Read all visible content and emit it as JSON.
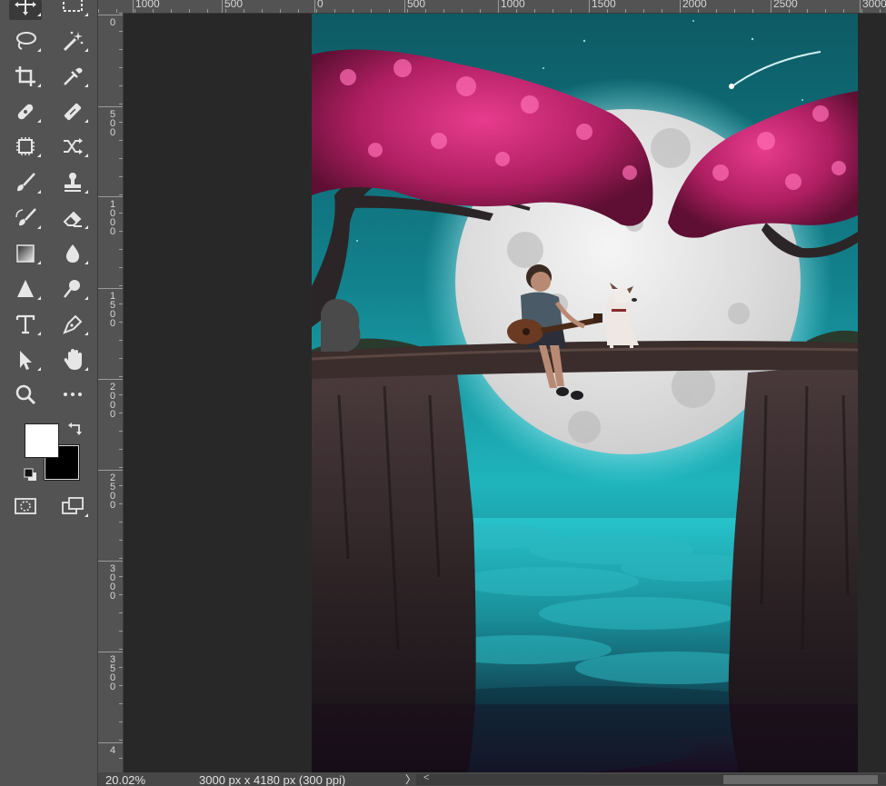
{
  "rulers": {
    "top_labels": [
      "1000",
      "500",
      "0",
      "500",
      "1000",
      "1500",
      "2000",
      "2500",
      "3000"
    ],
    "left_labels": [
      [
        "0"
      ],
      [
        "5",
        "0",
        "0"
      ],
      [
        "1",
        "0",
        "0",
        "0"
      ],
      [
        "1",
        "5",
        "0",
        "0"
      ],
      [
        "2",
        "0",
        "0",
        "0"
      ],
      [
        "2",
        "5",
        "0",
        "0"
      ],
      [
        "3",
        "0",
        "0",
        "0"
      ],
      [
        "3",
        "5",
        "0",
        "0"
      ],
      [
        "4"
      ]
    ]
  },
  "tools": [
    {
      "name": "move-tool",
      "icon": "move-icon"
    },
    {
      "name": "marquee-tool",
      "icon": "rect-marquee-icon"
    },
    {
      "name": "lasso-tool",
      "icon": "lasso-icon"
    },
    {
      "name": "magic-wand-tool",
      "icon": "magic-wand-icon"
    },
    {
      "name": "crop-tool",
      "icon": "crop-icon"
    },
    {
      "name": "eyedropper-tool",
      "icon": "eyedropper-icon"
    },
    {
      "name": "spot-healing-tool",
      "icon": "bandage-icon"
    },
    {
      "name": "healing-brush-tool",
      "icon": "patch-icon"
    },
    {
      "name": "content-aware-move-tool",
      "icon": "chip-icon"
    },
    {
      "name": "shuffle-tool",
      "icon": "shuffle-icon"
    },
    {
      "name": "brush-tool",
      "icon": "brush-icon"
    },
    {
      "name": "clone-stamp-tool",
      "icon": "stamp-icon"
    },
    {
      "name": "history-brush-tool",
      "icon": "history-brush-icon"
    },
    {
      "name": "eraser-tool",
      "icon": "eraser-icon"
    },
    {
      "name": "gradient-tool",
      "icon": "gradient-icon"
    },
    {
      "name": "blur-tool",
      "icon": "drop-icon"
    },
    {
      "name": "sharpen-tool",
      "icon": "triangle-icon"
    },
    {
      "name": "dodge-tool",
      "icon": "dodge-icon"
    },
    {
      "name": "type-tool",
      "icon": "type-icon"
    },
    {
      "name": "pen-tool",
      "icon": "pen-icon"
    },
    {
      "name": "path-selection-tool",
      "icon": "arrow-icon"
    },
    {
      "name": "hand-tool",
      "icon": "hand-icon"
    },
    {
      "name": "zoom-tool",
      "icon": "magnifier-icon"
    },
    {
      "name": "more-tools",
      "icon": "ellipsis-icon"
    },
    {
      "name": "quick-mask",
      "icon": "quick-mask-icon"
    },
    {
      "name": "screen-mode",
      "icon": "screen-mode-icon"
    }
  ],
  "colors": {
    "foreground": "#ffffff",
    "background": "#000000",
    "panel": "#535353",
    "workspace": "#282828"
  },
  "status": {
    "zoom": "20.02%",
    "doc_info": "3000 px x 4180 px (300 ppi)",
    "arrow": "〉",
    "scroll_left": "<"
  }
}
